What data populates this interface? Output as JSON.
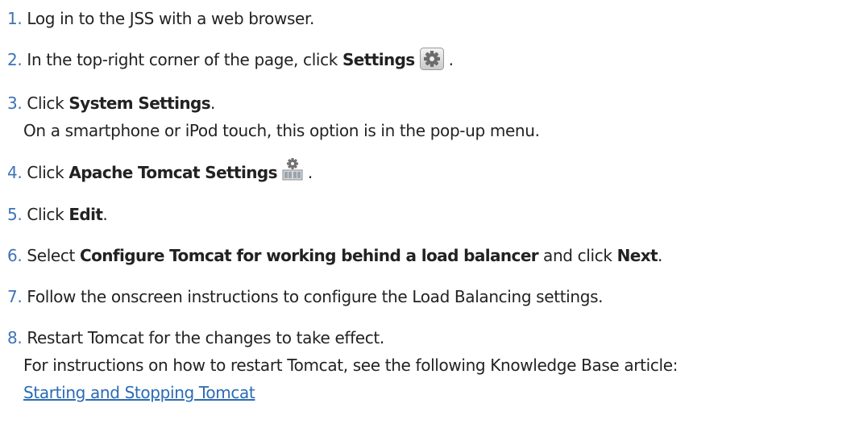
{
  "steps": [
    {
      "num": "1.",
      "text": "Log in to the JSS with a web browser."
    },
    {
      "num": "2.",
      "pre": "In the top-right corner of the page, click ",
      "bold": "Settings",
      "post": " .",
      "icon": "gear-icon"
    },
    {
      "num": "3.",
      "pre": "Click ",
      "bold": "System Settings",
      "post": ".",
      "note": "On a smartphone or iPod touch, this option is in the pop-up menu."
    },
    {
      "num": "4.",
      "pre": "Click ",
      "bold": "Apache Tomcat Settings",
      "post": " .",
      "icon": "tomcat-server-icon"
    },
    {
      "num": "5.",
      "pre": "Click ",
      "bold": "Edit",
      "post": "."
    },
    {
      "num": "6.",
      "pre": "Select ",
      "bold": "Configure Tomcat for working behind a load balancer",
      "mid": " and click ",
      "bold2": "Next",
      "post": "."
    },
    {
      "num": "7.",
      "text": "Follow the onscreen instructions to configure the Load Balancing settings."
    },
    {
      "num": "8.",
      "text": "Restart Tomcat for the changes to take effect.",
      "note": "For instructions on how to restart Tomcat, see the following Knowledge Base article:",
      "link": "Starting and Stopping Tomcat"
    }
  ],
  "colors": {
    "number": "#3f73b5",
    "link": "#2a6bb5",
    "text": "#222222"
  }
}
